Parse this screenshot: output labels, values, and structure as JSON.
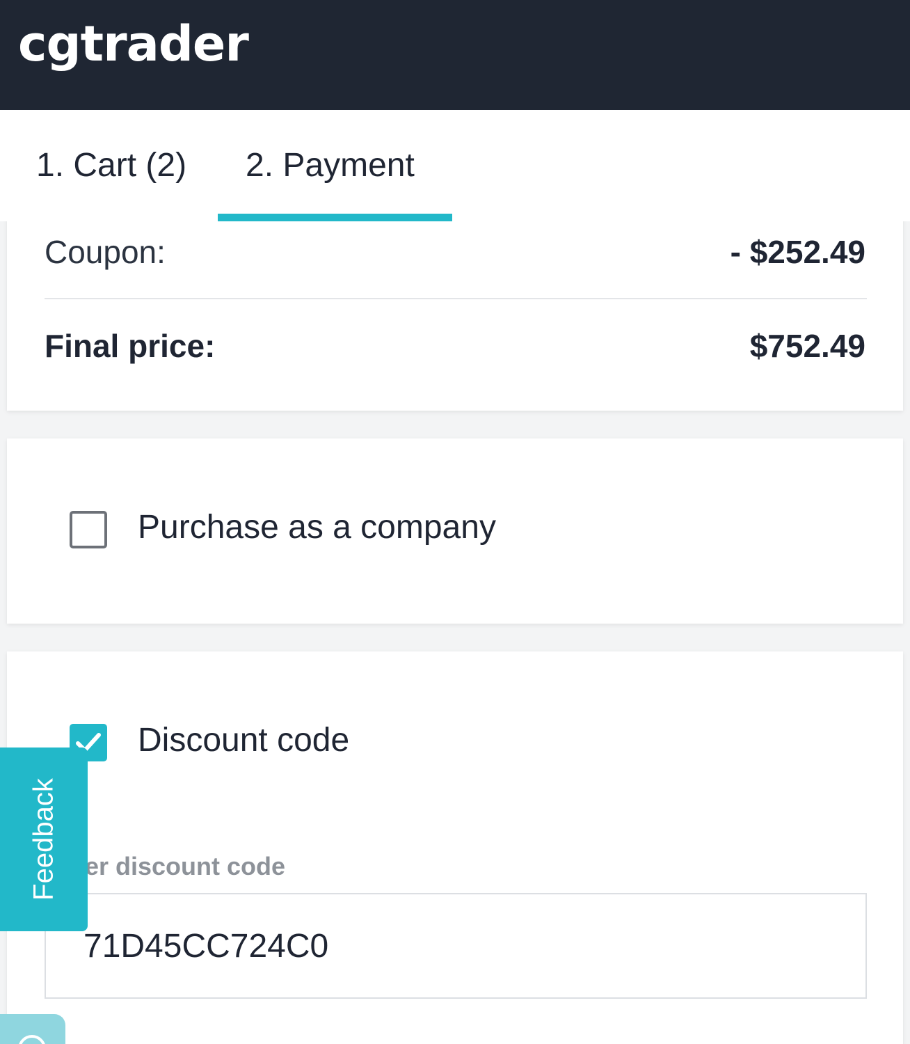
{
  "header": {
    "logo_text": "cgtrader"
  },
  "tabs": [
    {
      "label": "1. Cart (2)",
      "active": false
    },
    {
      "label": "2. Payment",
      "active": true
    }
  ],
  "summary": {
    "coupon_label": "Coupon:",
    "coupon_value": "- $252.49",
    "final_label": "Final price:",
    "final_value": "$752.49"
  },
  "company": {
    "label": "Purchase as a company",
    "checked": false
  },
  "discount": {
    "label": "Discount code",
    "checked": true,
    "field_label": "Enter discount code",
    "value": "71D45CC724C0"
  },
  "feedback": {
    "label": "Feedback"
  },
  "icons": {
    "checkbox_check": "check-icon",
    "chat": "chat-icon"
  },
  "colors": {
    "header_bg": "#1f2633",
    "accent": "#22b8c9"
  }
}
